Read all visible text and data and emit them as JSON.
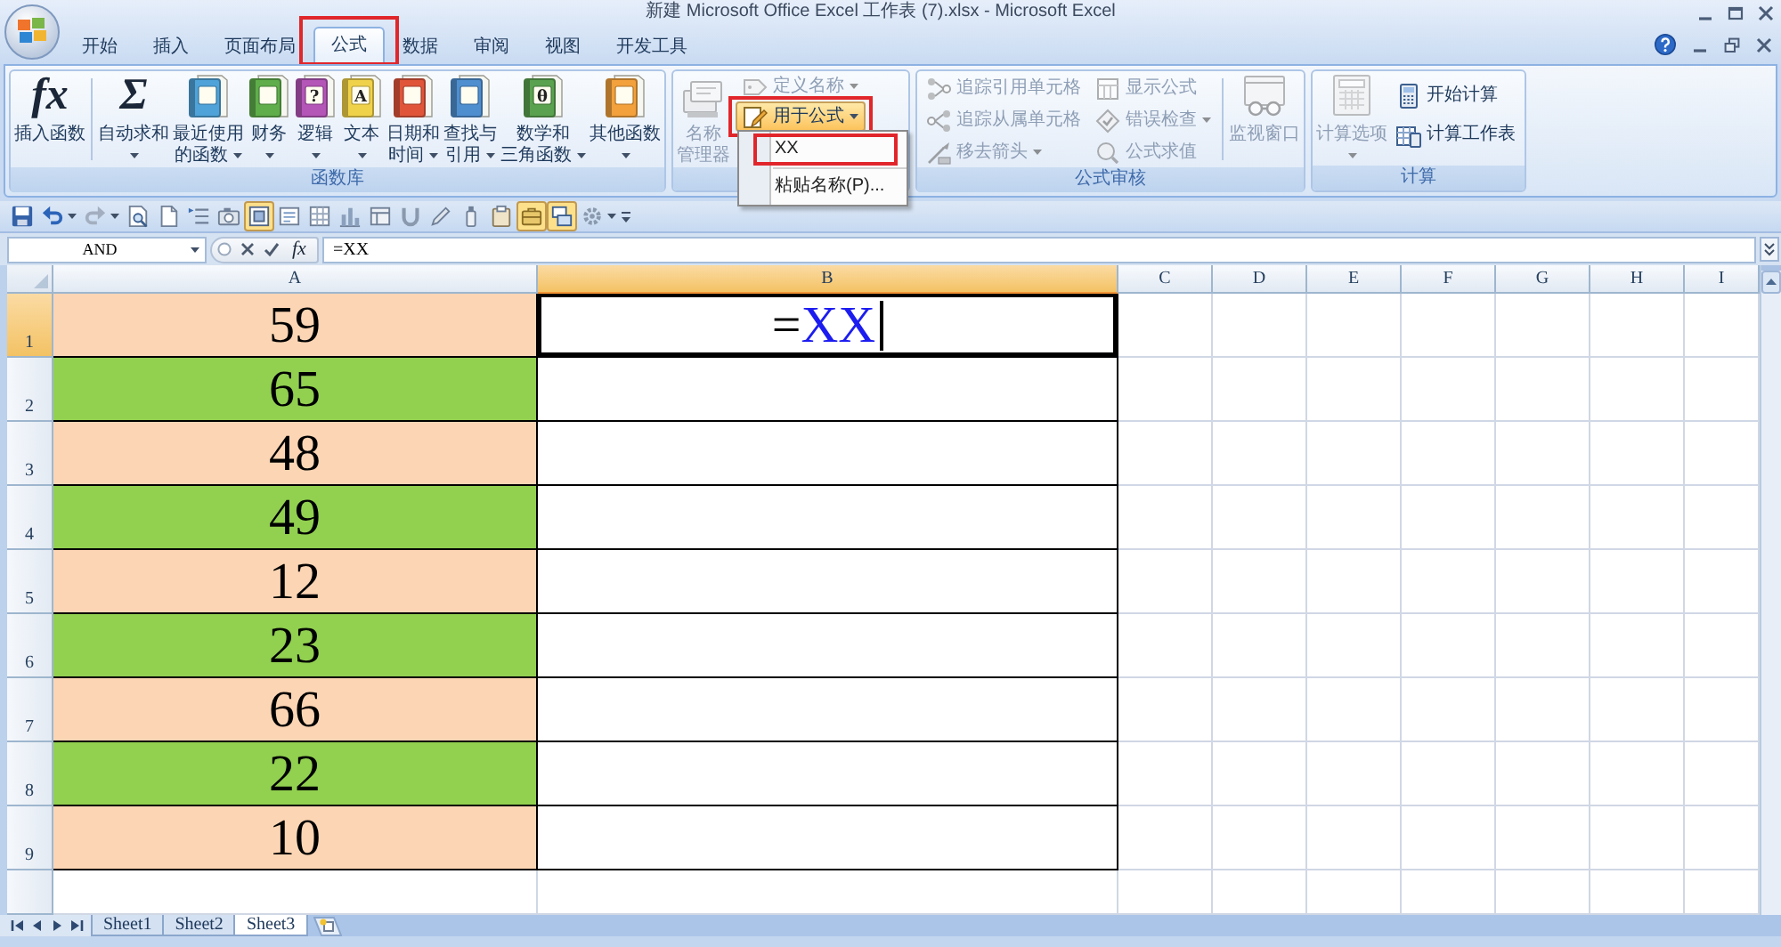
{
  "window": {
    "title": "新建 Microsoft Office Excel 工作表 (7).xlsx - Microsoft Excel"
  },
  "ribbon_tabs": [
    {
      "label": "开始",
      "selected": false,
      "annotated": false
    },
    {
      "label": "插入",
      "selected": false,
      "annotated": false
    },
    {
      "label": "页面布局",
      "selected": false,
      "annotated": false
    },
    {
      "label": "公式",
      "selected": true,
      "annotated": true
    },
    {
      "label": "数据",
      "selected": false,
      "annotated": false
    },
    {
      "label": "审阅",
      "selected": false,
      "annotated": false
    },
    {
      "label": "视图",
      "selected": false,
      "annotated": false
    },
    {
      "label": "开发工具",
      "selected": false,
      "annotated": false
    }
  ],
  "ribbon": {
    "groups": [
      {
        "kind": "function_library",
        "label": "函数库",
        "buttons": [
          {
            "kind": "glyph",
            "glyph": "fx",
            "lines": [
              "插入函数"
            ],
            "dropdown": false
          },
          {
            "kind": "glyph",
            "glyph": "Σ",
            "lines": [
              "自动求和"
            ],
            "dropdown": true
          },
          {
            "kind": "book",
            "color": "#4fa3d9",
            "lines": [
              "最近使用",
              "的函数"
            ],
            "dropdown": true
          },
          {
            "kind": "book",
            "color": "#5fae4b",
            "lines": [
              "财务"
            ],
            "dropdown": true
          },
          {
            "kind": "book",
            "color": "#b455b8",
            "glyph": "?",
            "lines": [
              "逻辑"
            ],
            "dropdown": true
          },
          {
            "kind": "book",
            "color": "#f0d24a",
            "glyph": "A",
            "lines": [
              "文本"
            ],
            "dropdown": true
          },
          {
            "kind": "book",
            "color": "#e0553a",
            "lines": [
              "日期和",
              "时间"
            ],
            "dropdown": true
          },
          {
            "kind": "book",
            "color": "#4f8fd0",
            "lines": [
              "查找与",
              "引用"
            ],
            "dropdown": true
          },
          {
            "kind": "book",
            "color": "#5aa24f",
            "glyph": "θ",
            "lines": [
              "数学和",
              "三角函数"
            ],
            "dropdown": true
          },
          {
            "kind": "book",
            "color": "#f3a13c",
            "lines": [
              "其他函数"
            ],
            "dropdown": true
          }
        ]
      },
      {
        "kind": "defined_names",
        "buttons": [
          {
            "kind": "large",
            "lines": [
              "名称",
              "管理器"
            ],
            "dropdown": false,
            "disabled": true,
            "pressed": false,
            "annotated": false
          },
          {
            "kind": "small",
            "label": "定义名称",
            "dropdown": true,
            "disabled": true,
            "pressed": false,
            "annotated": false
          },
          {
            "kind": "small",
            "label": "用于公式",
            "dropdown": true,
            "disabled": false,
            "pressed": true,
            "annotated": true
          }
        ],
        "menu": {
          "items": [
            {
              "label": "XX",
              "annotated": true
            },
            {
              "label": "粘贴名称(P)...",
              "annotated": false
            }
          ]
        }
      },
      {
        "kind": "formula_auditing",
        "label": "公式审核",
        "buttons": [
          {
            "kind": "small",
            "label": "追踪引用单元格",
            "dropdown": false,
            "disabled": true
          },
          {
            "kind": "small",
            "label": "追踪从属单元格",
            "dropdown": false,
            "disabled": true
          },
          {
            "kind": "small",
            "label": "移去箭头",
            "dropdown": true,
            "disabled": true
          },
          {
            "kind": "small",
            "label": "显示公式",
            "dropdown": false,
            "disabled": true
          },
          {
            "kind": "small",
            "label": "错误检查",
            "dropdown": true,
            "disabled": true
          },
          {
            "kind": "small",
            "label": "公式求值",
            "dropdown": false,
            "disabled": true
          },
          {
            "kind": "large",
            "lines": [
              "监视窗口"
            ],
            "dropdown": false,
            "disabled": true
          }
        ]
      },
      {
        "kind": "calculation",
        "label": "计算",
        "buttons": [
          {
            "kind": "large",
            "lines": [
              "计算选项"
            ],
            "dropdown": true,
            "disabled": true
          },
          {
            "kind": "small",
            "label": "开始计算",
            "dropdown": false,
            "disabled": false
          },
          {
            "kind": "small",
            "label": "计算工作表",
            "dropdown": false,
            "disabled": false
          }
        ]
      }
    ]
  },
  "quick_access": {
    "buttons": [
      {
        "pressed": false
      },
      {
        "pressed": false
      },
      {
        "pressed": false
      },
      {
        "pressed": false
      },
      {
        "pressed": false
      },
      {
        "pressed": false
      },
      {
        "pressed": false
      },
      {
        "pressed": true
      },
      {
        "pressed": false
      },
      {
        "pressed": false
      },
      {
        "pressed": false
      },
      {
        "pressed": false
      },
      {
        "pressed": false
      },
      {
        "pressed": false
      },
      {
        "pressed": false
      },
      {
        "pressed": false
      },
      {
        "pressed": true
      },
      {
        "pressed": true
      },
      {
        "pressed": false
      }
    ]
  },
  "formula_bar": {
    "name_box": "AND",
    "function_button": "fx",
    "formula": "=XX"
  },
  "columns": [
    {
      "label": "A",
      "selected": false
    },
    {
      "label": "B",
      "selected": true
    },
    {
      "label": "C",
      "selected": false
    },
    {
      "label": "D",
      "selected": false
    },
    {
      "label": "E",
      "selected": false
    },
    {
      "label": "F",
      "selected": false
    },
    {
      "label": "G",
      "selected": false
    },
    {
      "label": "H",
      "selected": false
    },
    {
      "label": "I",
      "selected": false
    }
  ],
  "rows": [
    {
      "header": "1",
      "selected": true,
      "cells": [
        {
          "value": "59",
          "color": "#fcd5b4",
          "active": false
        },
        {
          "active": true,
          "editing": true,
          "parts": [
            {
              "text": "=",
              "kind": "plain"
            },
            {
              "text": "XX",
              "kind": "reference"
            }
          ]
        }
      ]
    },
    {
      "header": "2",
      "selected": false,
      "cells": [
        {
          "value": "65",
          "color": "#92d050",
          "active": false
        },
        {
          "active": false,
          "editing": false
        }
      ]
    },
    {
      "header": "3",
      "selected": false,
      "cells": [
        {
          "value": "48",
          "color": "#fcd5b4",
          "active": false
        },
        {
          "active": false,
          "editing": false
        }
      ]
    },
    {
      "header": "4",
      "selected": false,
      "cells": [
        {
          "value": "49",
          "color": "#92d050",
          "active": false
        },
        {
          "active": false,
          "editing": false
        }
      ]
    },
    {
      "header": "5",
      "selected": false,
      "cells": [
        {
          "value": "12",
          "color": "#fcd5b4",
          "active": false
        },
        {
          "active": false,
          "editing": false
        }
      ]
    },
    {
      "header": "6",
      "selected": false,
      "cells": [
        {
          "value": "23",
          "color": "#92d050",
          "active": false
        },
        {
          "active": false,
          "editing": false
        }
      ]
    },
    {
      "header": "7",
      "selected": false,
      "cells": [
        {
          "value": "66",
          "color": "#fcd5b4",
          "active": false
        },
        {
          "active": false,
          "editing": false
        }
      ]
    },
    {
      "header": "8",
      "selected": false,
      "cells": [
        {
          "value": "22",
          "color": "#92d050",
          "active": false
        },
        {
          "active": false,
          "editing": false
        }
      ]
    },
    {
      "header": "9",
      "selected": false,
      "cells": [
        {
          "value": "10",
          "color": "#fcd5b4",
          "active": false
        },
        {
          "active": false,
          "editing": false
        }
      ]
    }
  ],
  "sheet_tabs": [
    {
      "label": "Sheet1",
      "selected": false
    },
    {
      "label": "Sheet2",
      "selected": false
    },
    {
      "label": "Sheet3",
      "selected": true
    }
  ]
}
